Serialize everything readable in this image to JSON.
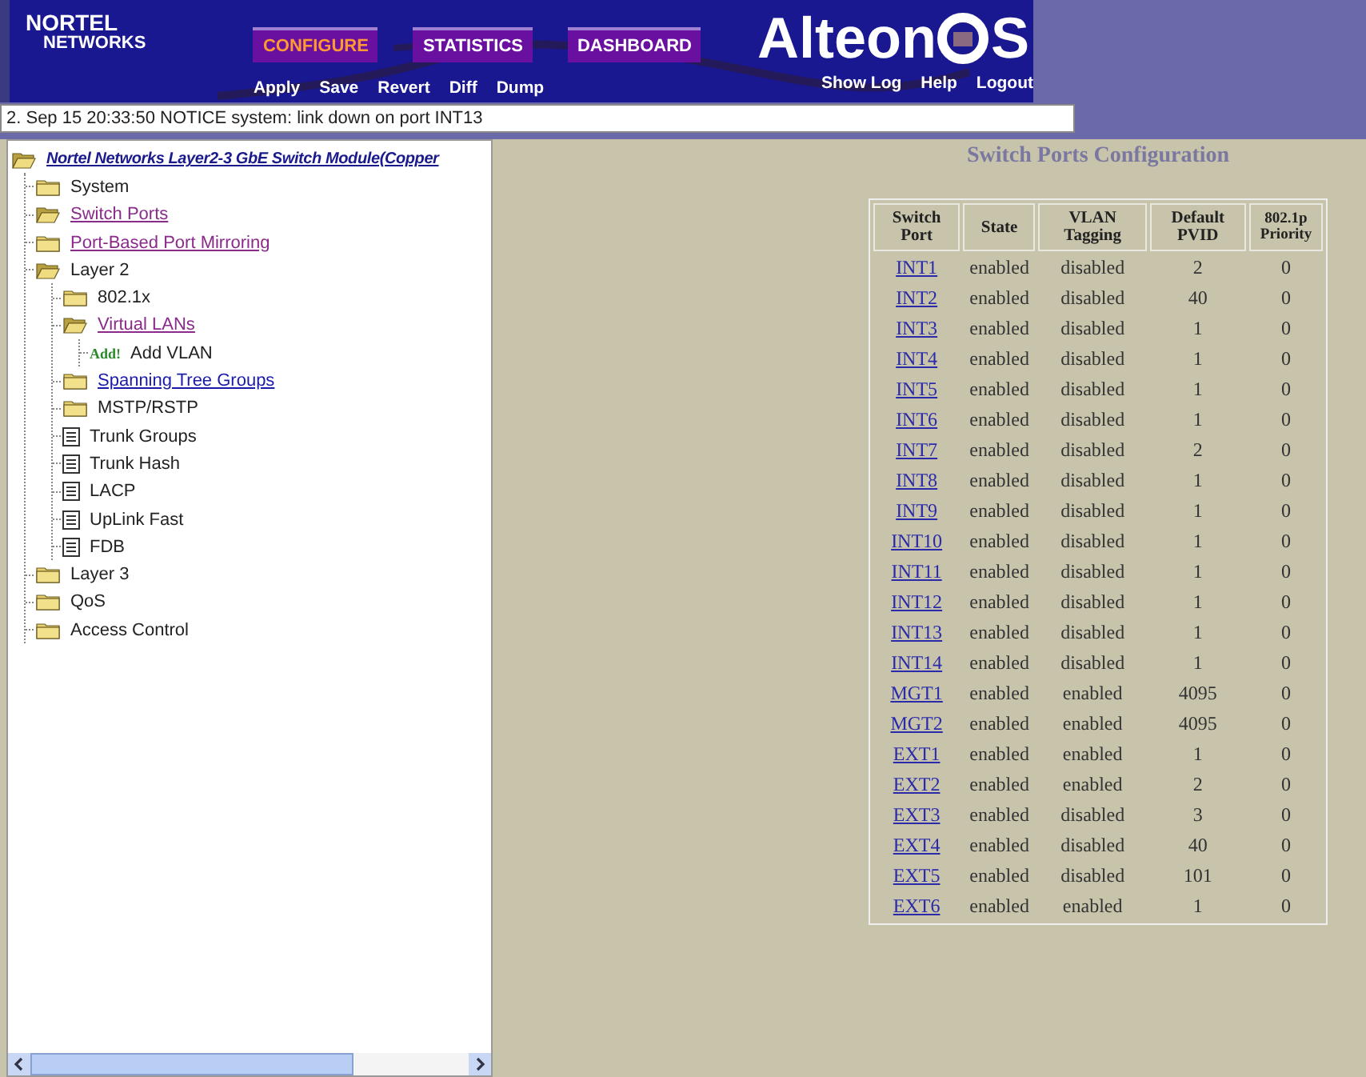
{
  "header": {
    "logo_top": "NORTEL",
    "logo_bottom": "NETWORKS",
    "brand_left": "Alteon",
    "brand_right": "S",
    "tabs": [
      {
        "label": "CONFIGURE",
        "selected": true
      },
      {
        "label": "STATISTICS",
        "selected": false
      },
      {
        "label": "DASHBOARD",
        "selected": false
      }
    ],
    "actions": [
      "Apply",
      "Save",
      "Revert",
      "Diff",
      "Dump"
    ],
    "links": [
      "Show Log",
      "Help",
      "Logout"
    ]
  },
  "notice": "2. Sep 15 20:33:50 NOTICE  system: link down on port INT13",
  "tree": {
    "label": "Nortel Networks Layer2-3 GbE Switch Module(Copper",
    "children": [
      {
        "kind": "folder",
        "label": "System",
        "expanded": false,
        "link": false
      },
      {
        "kind": "folder",
        "label": "Switch Ports",
        "expanded": true,
        "link": true,
        "visited": true
      },
      {
        "kind": "folder",
        "label": "Port-Based Port Mirroring",
        "expanded": false,
        "link": true,
        "visited": true
      },
      {
        "kind": "folder",
        "label": "Layer 2",
        "expanded": true,
        "link": false,
        "children": [
          {
            "kind": "folder",
            "label": "802.1x",
            "expanded": false,
            "link": false
          },
          {
            "kind": "folder",
            "label": "Virtual LANs",
            "expanded": true,
            "link": true,
            "visited": true,
            "children": [
              {
                "kind": "add",
                "badge": "Add!",
                "label": "Add VLAN",
                "link": false
              }
            ]
          },
          {
            "kind": "folder",
            "label": "Spanning Tree Groups",
            "expanded": false,
            "link": true,
            "visited": false
          },
          {
            "kind": "folder",
            "label": "MSTP/RSTP",
            "expanded": false,
            "link": false
          },
          {
            "kind": "page",
            "label": "Trunk Groups",
            "link": false
          },
          {
            "kind": "page",
            "label": "Trunk Hash",
            "link": false
          },
          {
            "kind": "page",
            "label": "LACP",
            "link": false
          },
          {
            "kind": "page",
            "label": "UpLink Fast",
            "link": false
          },
          {
            "kind": "page",
            "label": "FDB",
            "link": false
          }
        ]
      },
      {
        "kind": "folder",
        "label": "Layer 3",
        "expanded": false,
        "link": false
      },
      {
        "kind": "folder",
        "label": "QoS",
        "expanded": false,
        "link": false
      },
      {
        "kind": "folder",
        "label": "Access Control",
        "expanded": false,
        "link": false
      }
    ]
  },
  "title": "Switch Ports Configuration",
  "table": {
    "columns": [
      "Switch Port",
      "State",
      "VLAN Tagging",
      "Default PVID",
      "802.1p Priority"
    ],
    "rows": [
      [
        "INT1",
        "enabled",
        "disabled",
        "2",
        "0"
      ],
      [
        "INT2",
        "enabled",
        "disabled",
        "40",
        "0"
      ],
      [
        "INT3",
        "enabled",
        "disabled",
        "1",
        "0"
      ],
      [
        "INT4",
        "enabled",
        "disabled",
        "1",
        "0"
      ],
      [
        "INT5",
        "enabled",
        "disabled",
        "1",
        "0"
      ],
      [
        "INT6",
        "enabled",
        "disabled",
        "1",
        "0"
      ],
      [
        "INT7",
        "enabled",
        "disabled",
        "2",
        "0"
      ],
      [
        "INT8",
        "enabled",
        "disabled",
        "1",
        "0"
      ],
      [
        "INT9",
        "enabled",
        "disabled",
        "1",
        "0"
      ],
      [
        "INT10",
        "enabled",
        "disabled",
        "1",
        "0"
      ],
      [
        "INT11",
        "enabled",
        "disabled",
        "1",
        "0"
      ],
      [
        "INT12",
        "enabled",
        "disabled",
        "1",
        "0"
      ],
      [
        "INT13",
        "enabled",
        "disabled",
        "1",
        "0"
      ],
      [
        "INT14",
        "enabled",
        "disabled",
        "1",
        "0"
      ],
      [
        "MGT1",
        "enabled",
        "enabled",
        "4095",
        "0"
      ],
      [
        "MGT2",
        "enabled",
        "enabled",
        "4095",
        "0"
      ],
      [
        "EXT1",
        "enabled",
        "enabled",
        "1",
        "0"
      ],
      [
        "EXT2",
        "enabled",
        "enabled",
        "2",
        "0"
      ],
      [
        "EXT3",
        "enabled",
        "disabled",
        "3",
        "0"
      ],
      [
        "EXT4",
        "enabled",
        "disabled",
        "40",
        "0"
      ],
      [
        "EXT5",
        "enabled",
        "disabled",
        "101",
        "0"
      ],
      [
        "EXT6",
        "enabled",
        "enabled",
        "1",
        "0"
      ]
    ]
  }
}
